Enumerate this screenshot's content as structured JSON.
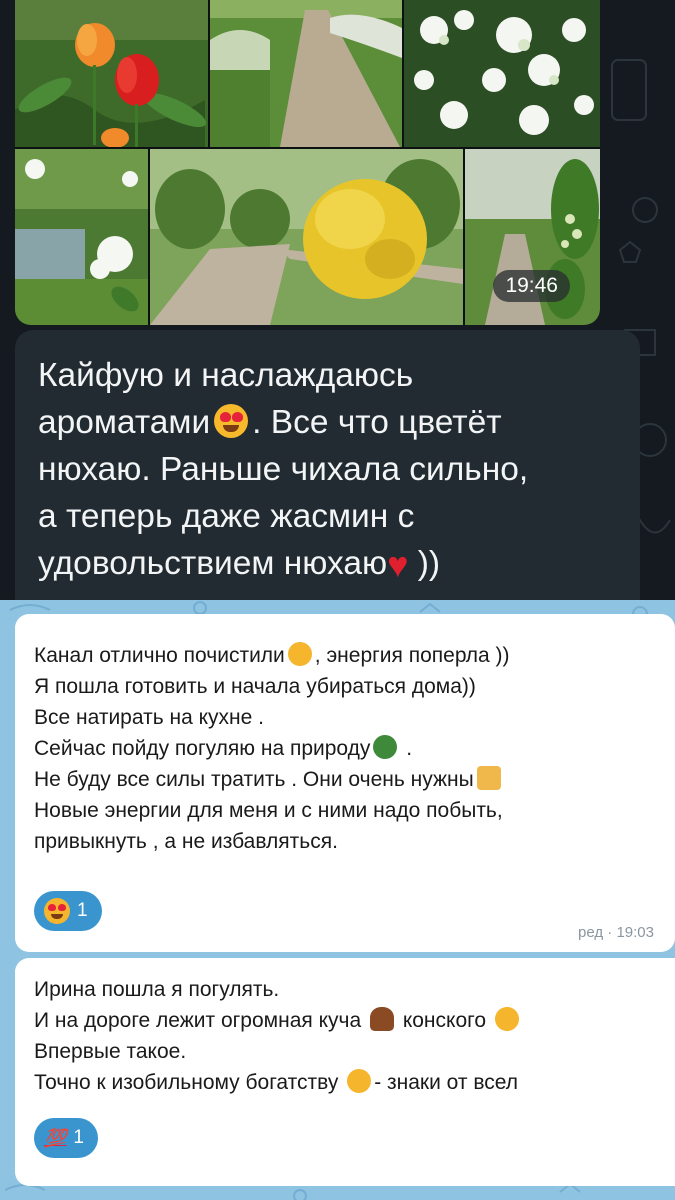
{
  "dark_message": {
    "album_time": "19:46",
    "lines": [
      "Кайфую и наслаждаюсь",
      "ароматами",
      ". Все что цветёт",
      "нюхаю. Раньше чихала сильно,",
      "а теперь даже жасмин с",
      "удовольствием нюхаю",
      " ))"
    ]
  },
  "light_messages": [
    {
      "lines": [
        "Канал отлично почистили",
        ", энергия поперла ))",
        "Я пошла готовить и начала убираться дома))",
        "Все натирать на кухне .",
        "Сейчас пойду погуляю на природу",
        " .",
        "Не буду все силы тратить . Они очень нужны",
        "Новые  энергии для меня и с ними  надо побыть,",
        "привыкнуть , а не избавляться."
      ],
      "reaction_count": "1",
      "time": "ред · 19:03"
    },
    {
      "lines": [
        "Ирина пошла я погулять.",
        "И на дороге лежит огромная куча",
        " конского ",
        "Впервые такое.",
        "Точно к изобильному богатству",
        "- знаки от всел"
      ],
      "reaction_label": "💯",
      "reaction_count": "1"
    }
  ],
  "colors": {
    "dark_bg": "#141a1f",
    "dark_bubble": "#222b31",
    "light_bg": "#8ec3e2",
    "reaction_blue": "#3a95cf"
  }
}
